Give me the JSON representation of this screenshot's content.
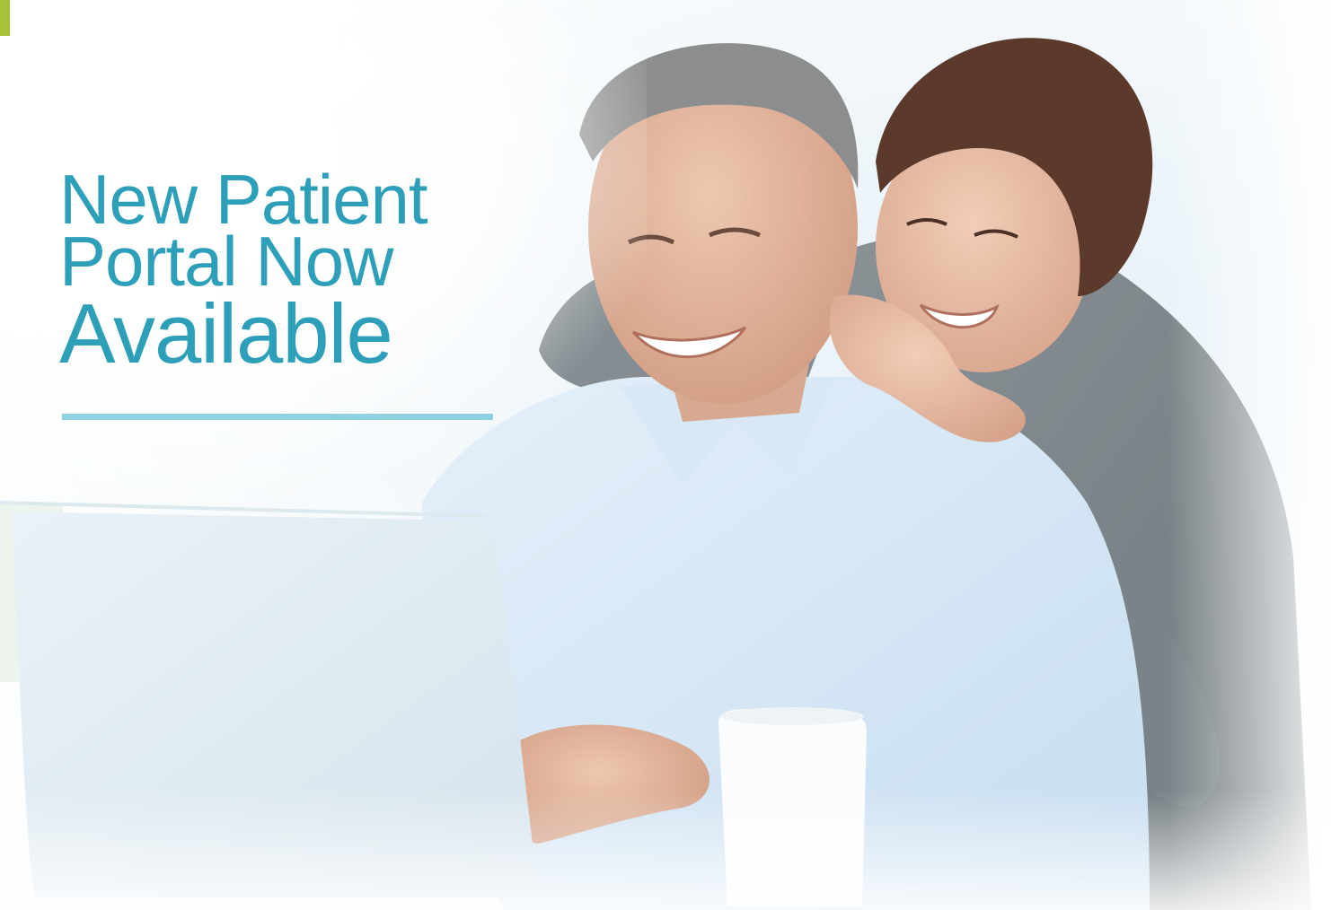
{
  "banner": {
    "headline": {
      "line1": "New Patient",
      "line2": "Portal Now",
      "line3": "Available"
    },
    "photo": "couple-using-laptop-photo",
    "colors": {
      "headline": "#2e9fb8",
      "underline": "#8fd1e3",
      "corner_accent": "#a6c23a",
      "background": "#f9fbfc"
    }
  }
}
